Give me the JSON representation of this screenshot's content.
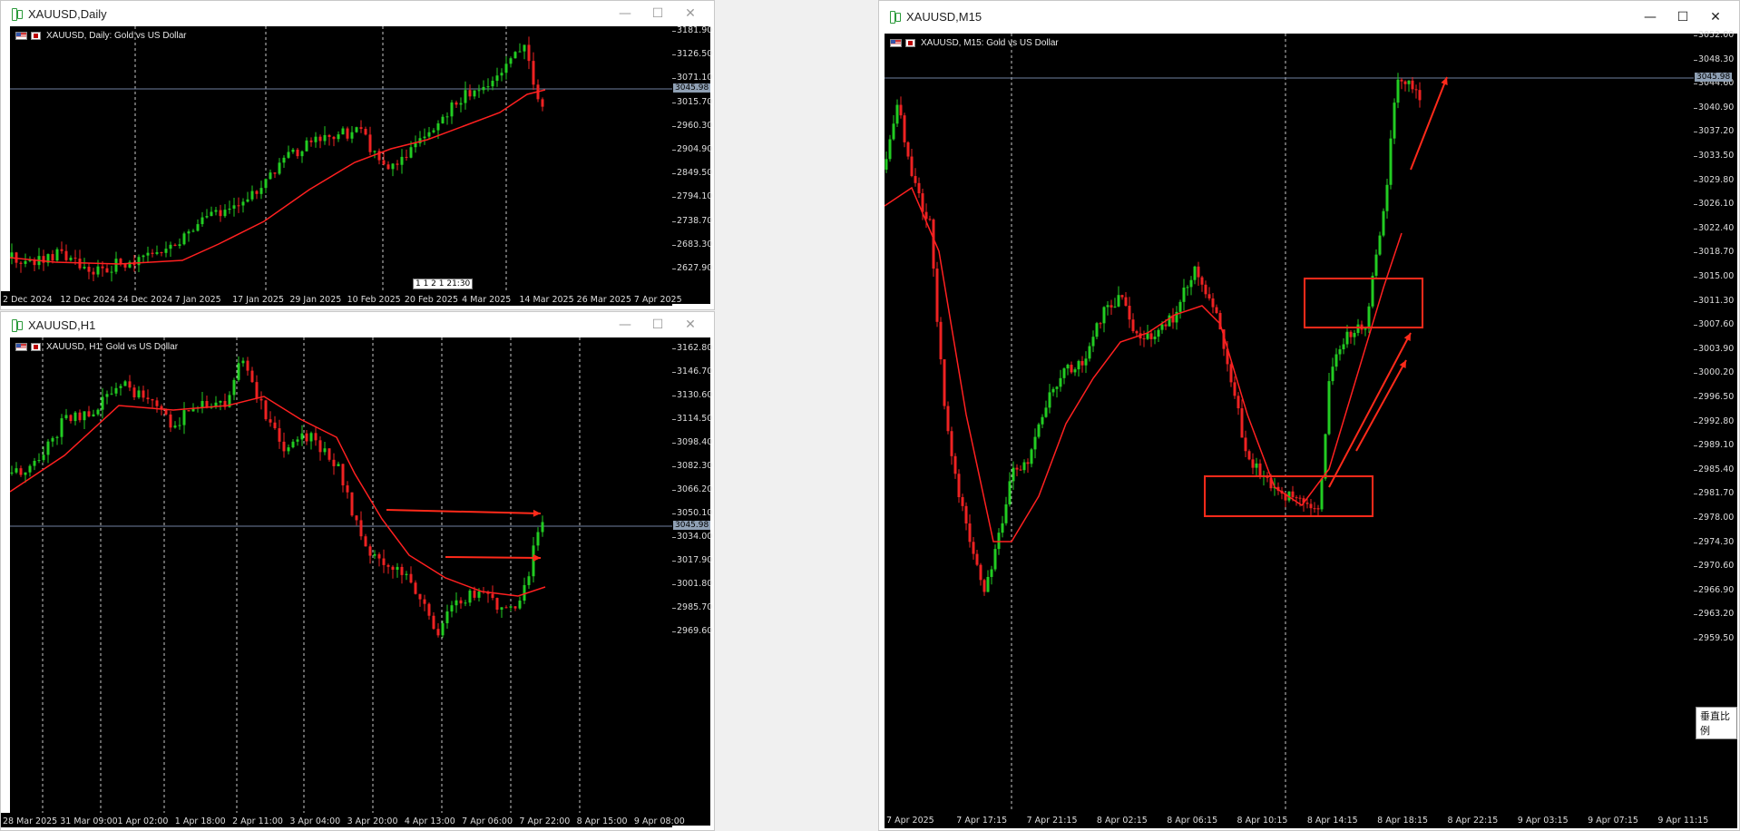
{
  "windows": {
    "daily": {
      "title": "XAUUSD,Daily",
      "chart_title": "XAUUSD, Daily:  Gold vs US Dollar",
      "price_ticks": [
        "3181.90",
        "3126.50",
        "3071.10",
        "3015.70",
        "2960.30",
        "2904.90",
        "2849.50",
        "2794.10",
        "2738.70",
        "2683.30",
        "2627.90"
      ],
      "current_price": "3045.98",
      "time_labels": [
        "2 Dec 2024",
        "12 Dec 2024",
        "24 Dec 2024",
        "7 Jan 2025",
        "17 Jan 2025",
        "29 Jan 2025",
        "10 Feb 2025",
        "20 Feb 2025",
        "4 Mar 2025",
        "14 Mar 2025",
        "26 Mar 2025",
        "7 Apr 2025"
      ],
      "countdown": "1 1 2 1 21:30"
    },
    "h1": {
      "title": "XAUUSD,H1",
      "chart_title": "XAUUSD, H1:  Gold vs US Dollar",
      "price_ticks": [
        "3162.80",
        "3146.70",
        "3130.60",
        "3114.50",
        "3098.40",
        "3082.30",
        "3066.20",
        "3050.10",
        "3034.00",
        "3017.90",
        "3001.80",
        "2985.70",
        "2969.60"
      ],
      "current_price": "3045.98",
      "time_labels": [
        "28 Mar 2025",
        "31 Mar 09:00",
        "1 Apr 02:00",
        "1 Apr 18:00",
        "2 Apr 11:00",
        "3 Apr 04:00",
        "3 Apr 20:00",
        "4 Apr 13:00",
        "7 Apr 06:00",
        "7 Apr 22:00",
        "8 Apr 15:00",
        "9 Apr 08:00"
      ]
    },
    "m15": {
      "title": "XAUUSD,M15",
      "chart_title": "XAUUSD, M15:  Gold vs US Dollar",
      "price_ticks": [
        "3052.00",
        "3048.30",
        "3044.60",
        "3040.90",
        "3037.20",
        "3033.50",
        "3029.80",
        "3026.10",
        "3022.40",
        "3018.70",
        "3015.00",
        "3011.30",
        "3007.60",
        "3003.90",
        "3000.20",
        "2996.50",
        "2992.80",
        "2989.10",
        "2985.40",
        "2981.70",
        "2978.00",
        "2974.30",
        "2970.60",
        "2966.90",
        "2963.20",
        "2959.50"
      ],
      "current_price": "3045.98",
      "time_labels": [
        "7 Apr 2025",
        "7 Apr 17:15",
        "7 Apr 21:15",
        "8 Apr 02:15",
        "8 Apr 06:15",
        "8 Apr 10:15",
        "8 Apr 14:15",
        "8 Apr 18:15",
        "8 Apr 22:15",
        "9 Apr 03:15",
        "9 Apr 07:15",
        "9 Apr 11:15"
      ],
      "scale_button": "垂直比例"
    }
  },
  "controls": {
    "minimize": "—",
    "maximize": "☐",
    "close": "✕"
  },
  "colors": {
    "bull": "#22cc22",
    "bear": "#ee2222",
    "ma": "#ff2020",
    "annotation": "#ff2a1a",
    "grid": "#c8c8c8"
  }
}
